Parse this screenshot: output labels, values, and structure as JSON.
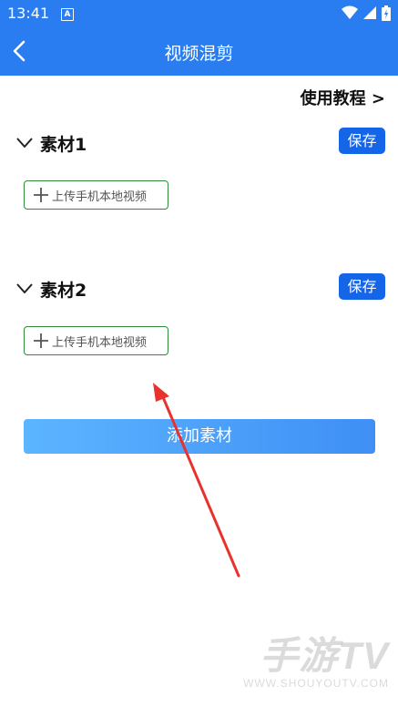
{
  "status_bar": {
    "time": "13:41",
    "notification_badge": "A",
    "icons": [
      "wifi-icon",
      "signal-icon",
      "battery-icon"
    ]
  },
  "app_bar": {
    "title": "视频混剪",
    "back_icon": "back-arrow-icon"
  },
  "tutorial_link": "使用教程 >",
  "sections": [
    {
      "title": "素材1",
      "save_label": "保存",
      "upload_label": "上传手机本地视频"
    },
    {
      "title": "素材2",
      "save_label": "保存",
      "upload_label": "上传手机本地视频"
    }
  ],
  "add_material_label": "添加素材",
  "watermark": {
    "brand": "手游TV",
    "url": "WWW.SHOUYOUTV.COM"
  },
  "colors": {
    "primary": "#2a7df1",
    "save_button": "#1565e8",
    "upload_border": "#2e8b3a",
    "annotation_arrow": "#e8322e"
  }
}
